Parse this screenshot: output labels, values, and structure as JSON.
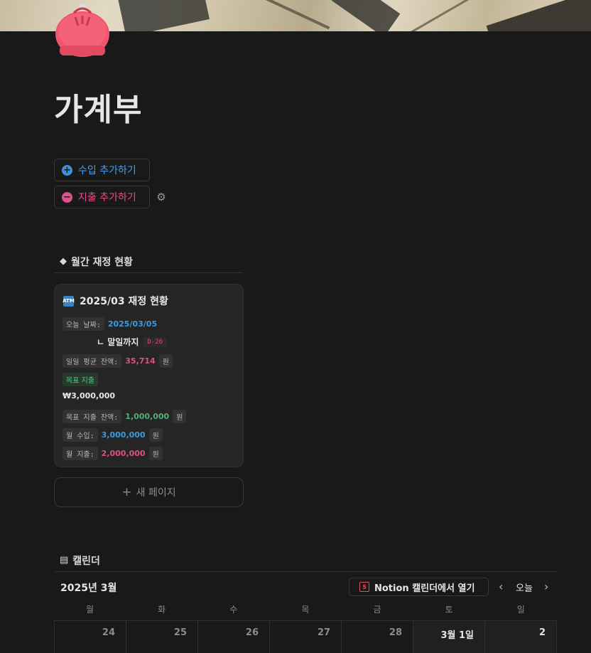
{
  "page": {
    "title": "가계부",
    "icon": "coin-purse-icon"
  },
  "actions": {
    "add_income": "수입 추가하기",
    "add_expense": "지출 추가하기",
    "settings_icon": "gear-icon",
    "income_color": "#3d8fe0",
    "expense_color": "#e0508a"
  },
  "finance": {
    "section_title": "월간 재정 현황",
    "card_title": "2025/03 재정 현황",
    "today_label": "오늘 날짜:",
    "today_value": "2025/03/05",
    "until_label": "ㄴ 말일까지",
    "d_day": "D-26",
    "daily_avg_label": "일일 평균 잔액:",
    "daily_avg_value": "35,714",
    "unit": "원",
    "goal_label": "목표 지출",
    "goal_amount": "₩3,000,000",
    "goal_remaining_label": "목표 지출 잔액:",
    "goal_remaining_value": "1,000,000",
    "income_label": "월 수입:",
    "income_value": "3,000,000",
    "expense_label": "월 지출:",
    "expense_value": "2,000,000",
    "new_page": "새 페이지"
  },
  "calendar": {
    "section_title": "캘린더",
    "month": "2025년 3월",
    "open_notion": "Notion 캘린더에서 열기",
    "today": "오늘",
    "weekdays": [
      "월",
      "화",
      "수",
      "목",
      "금",
      "토",
      "일"
    ],
    "days": [
      "24",
      "25",
      "26",
      "27",
      "28",
      "3월 1일",
      "2"
    ]
  }
}
